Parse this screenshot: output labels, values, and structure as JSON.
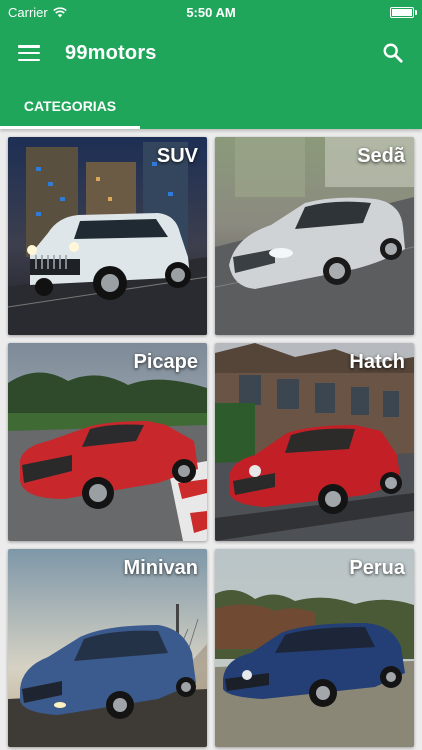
{
  "status": {
    "carrier": "Carrier",
    "time": "5:50 AM"
  },
  "appbar": {
    "title": "99motors",
    "menu_icon": "hamburger-menu-icon",
    "search_icon": "search-icon"
  },
  "tabs": [
    {
      "label": "CATEGORIAS",
      "selected": true
    }
  ],
  "categories": [
    {
      "label": "SUV",
      "car_color": "#dfe6ea"
    },
    {
      "label": "Sedã",
      "car_color": "#cfd3d6"
    },
    {
      "label": "Picape",
      "car_color": "#c8282c"
    },
    {
      "label": "Hatch",
      "car_color": "#c22026"
    },
    {
      "label": "Minivan",
      "car_color": "#3b5a8e"
    },
    {
      "label": "Perua",
      "car_color": "#233f75"
    }
  ],
  "colors": {
    "primary": "#1fa65a",
    "background": "#ececec"
  }
}
